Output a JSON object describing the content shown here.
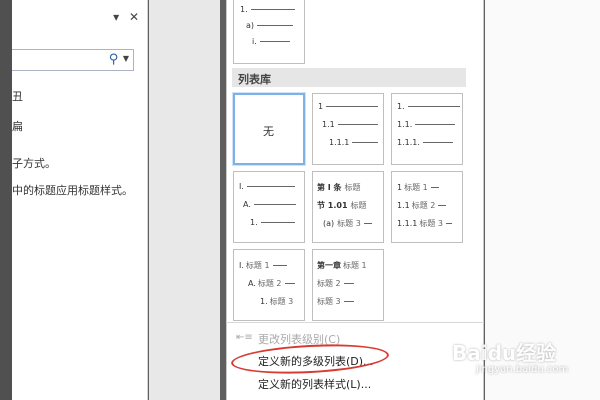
{
  "nav_pane": {
    "dropdown_icon": "▾",
    "close_icon": "✕",
    "search_placeholder": "",
    "text_fragments": [
      "丑",
      "扁",
      "子方式。",
      "中的标题应用标题样式。"
    ]
  },
  "dropdown": {
    "top_thumb": {
      "rows": [
        "1.",
        "a)",
        "i."
      ]
    },
    "section_title": "列表库",
    "thumbs": [
      {
        "name": "none",
        "label": "无"
      },
      {
        "name": "numeric-plain",
        "rows": [
          "1",
          "1.1",
          "1.1.1"
        ]
      },
      {
        "name": "numeric-dot",
        "rows": [
          "1.",
          "1.1.",
          "1.1.1."
        ]
      },
      {
        "name": "roman-alpha",
        "rows": [
          "I.",
          "A.",
          "1."
        ]
      },
      {
        "name": "article-section",
        "rows": [
          {
            "label": "第 Ⅰ 条",
            "text": "标题"
          },
          {
            "label": "节 1.01",
            "text": "标题"
          },
          {
            "label": "(a)",
            "text": "标题 3"
          }
        ]
      },
      {
        "name": "heading-numeric",
        "rows": [
          {
            "label": "1",
            "text": "标题 1"
          },
          {
            "label": "1.1",
            "text": "标题 2"
          },
          {
            "label": "1.1.1",
            "text": "标题 3"
          }
        ]
      },
      {
        "name": "heading-roman",
        "rows": [
          {
            "label": "I.",
            "text": "标题 1"
          },
          {
            "label": "A.",
            "text": "标题 2"
          },
          {
            "label": "1.",
            "text": "标题 3"
          }
        ]
      },
      {
        "name": "heading-chapter",
        "rows": [
          {
            "label": "第一章",
            "text": "标题 1"
          },
          {
            "label": "",
            "text": "标题 2"
          },
          {
            "label": "",
            "text": "标题 3"
          }
        ]
      }
    ],
    "menu": {
      "change_level": "更改列表级别(C)",
      "define_multilevel": "定义新的多级列表(D)...",
      "define_style": "定义新的列表样式(L)..."
    }
  },
  "watermark": {
    "main": "Baidu经验",
    "sub": "jingyan.baidu.com"
  }
}
